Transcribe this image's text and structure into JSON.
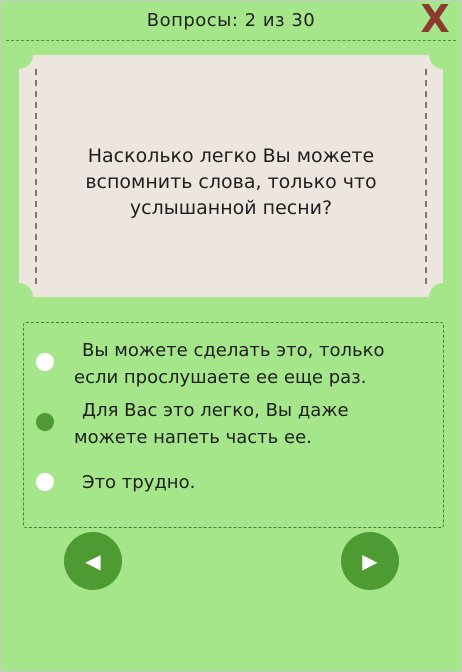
{
  "header": {
    "title": "Вопросы: 2 из 30",
    "close_label": "X"
  },
  "question": {
    "line1": "Насколько легко Вы можете",
    "line2": "вспомнить слова, только что",
    "line3": "услышанной песни?"
  },
  "answers": [
    {
      "line1": "Вы можете сделать это, только",
      "line2": "если прослушаете ее еще раз.",
      "selected": false
    },
    {
      "line1": "Для Вас это легко, Вы даже",
      "line2": "можете напеть часть ее.",
      "selected": true
    },
    {
      "line1": "Это трудно.",
      "line2": "",
      "selected": false
    }
  ],
  "nav": {
    "prev_icon": "◀",
    "next_icon": "▶"
  },
  "colors": {
    "background": "#a6e68a",
    "card": "#ece6df",
    "accent": "#4e9a33",
    "close": "#8a3a2e"
  }
}
